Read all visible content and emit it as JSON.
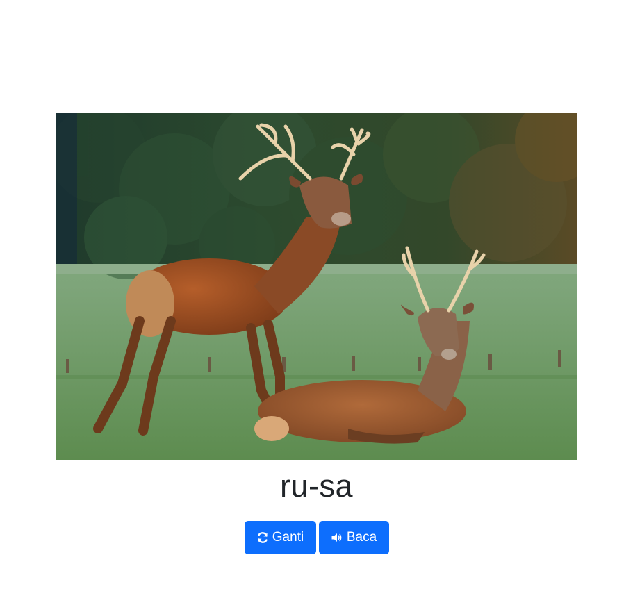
{
  "word": {
    "syllables": "ru-sa"
  },
  "image": {
    "subject": "two red deer stags on a grassy field with trees behind"
  },
  "buttons": {
    "replace": {
      "label": "Ganti",
      "icon": "refresh-icon"
    },
    "read": {
      "label": "Baca",
      "icon": "volume-icon"
    }
  },
  "colors": {
    "primary": "#0d6efd",
    "text": "#212529",
    "background": "#ffffff"
  }
}
